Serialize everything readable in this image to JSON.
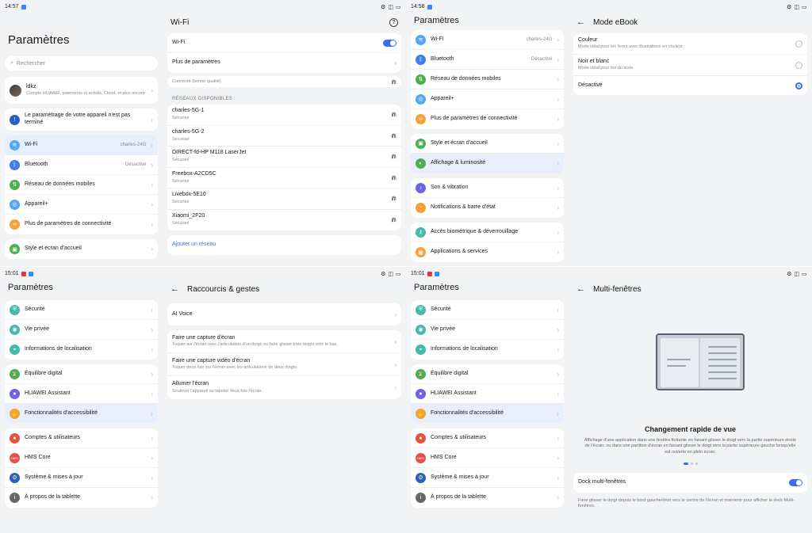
{
  "q1": {
    "status": {
      "time": "14:57",
      "icons": "⚙ ◫ ▭"
    },
    "settings": {
      "title": "Paramètres",
      "search_placeholder": "Rechercher",
      "account": {
        "name": "ldkz",
        "desc": "Compte HUAWEI, paiements et achats, Cloud, et plus encore"
      },
      "setup_notice": "Le paramétrage de votre appareil n'est pas terminé",
      "items": [
        {
          "label": "Wi-Fi",
          "value": "charles-24G",
          "icon": "wifi-icon"
        },
        {
          "label": "Bluetooth",
          "value": "Désactivé",
          "icon": "bluetooth-icon"
        },
        {
          "label": "Réseau de données mobiles",
          "value": "",
          "icon": "mobile-data-icon"
        },
        {
          "label": "Appareil+",
          "value": "",
          "icon": "device-plus-icon"
        },
        {
          "label": "Plus de paramètres de connectivité",
          "value": "",
          "icon": "link-icon"
        }
      ],
      "style_item": "Style et écran d'accueil"
    },
    "wifi": {
      "title": "Wi-Fi",
      "toggle_label": "Wi-Fi",
      "more_params": "Plus de paramètres",
      "connected_status": "Connecté (bonne qualité)",
      "available_label": "RÉSEAUX DISPONIBLES",
      "networks": [
        {
          "name": "charles-5G-1",
          "sec": "Sécurisé"
        },
        {
          "name": "charles-5G-2",
          "sec": "Sécurisé"
        },
        {
          "name": "DIRECT-fd-HP M118 LaserJet",
          "sec": "Sécurisé"
        },
        {
          "name": "Freebox-A2CD5C",
          "sec": "Sécurisé"
        },
        {
          "name": "Livebox-5E10",
          "sec": "Sécurisé"
        },
        {
          "name": "Xiaomi_2F20",
          "sec": "Sécurisé"
        }
      ],
      "add_network": "Ajouter un réseau"
    }
  },
  "q2": {
    "status": {
      "time": "14:58",
      "icons": "⚙ ◫ ▭"
    },
    "settings": {
      "title": "Paramètres",
      "group1": [
        {
          "label": "Wi-Fi",
          "value": "charles-24G"
        },
        {
          "label": "Bluetooth",
          "value": "Désactivé"
        },
        {
          "label": "Réseau de données mobiles",
          "value": ""
        },
        {
          "label": "Appareil+",
          "value": ""
        },
        {
          "label": "Plus de paramètres de connectivité",
          "value": ""
        }
      ],
      "group2": [
        {
          "label": "Style et écran d'accueil"
        },
        {
          "label": "Affichage & luminosité"
        }
      ],
      "group3": [
        {
          "label": "Son & vibration"
        },
        {
          "label": "Notifications & barre d'état"
        }
      ],
      "group4": [
        {
          "label": "Accès biométrique & déverrouillage"
        },
        {
          "label": "Applications & services"
        }
      ]
    },
    "ebook": {
      "title": "Mode eBook",
      "options": [
        {
          "label": "Couleur",
          "desc": "Mode idéal pour les livres avec illustrations en couleur."
        },
        {
          "label": "Noir et blanc",
          "desc": "Mode idéal pour lire du texte."
        },
        {
          "label": "Désactivé",
          "desc": ""
        }
      ]
    }
  },
  "q3": {
    "status": {
      "time": "15:01",
      "icons": "⚙ ◫ ▭"
    },
    "settings": {
      "title": "Paramètres",
      "group1": [
        {
          "label": "Sécurité"
        },
        {
          "label": "Vie privée"
        },
        {
          "label": "Informations de localisation"
        }
      ],
      "group2": [
        {
          "label": "Équilibre digital"
        },
        {
          "label": "HUAWEI Assistant"
        },
        {
          "label": "Fonctionnalités d'accessibilité"
        }
      ],
      "group3": [
        {
          "label": "Comptes & utilisateurs"
        },
        {
          "label": "HMS Core"
        },
        {
          "label": "Système & mises à jour"
        },
        {
          "label": "À propos de la tablette"
        }
      ]
    },
    "gestures": {
      "title": "Raccourcis & gestes",
      "ai_voice": "AI Voice",
      "items": [
        {
          "label": "Faire une capture d'écran",
          "desc": "Toquer sur l'écran avec l'articulation d'un doigt, ou faire glisser trois doigts vers le bas."
        },
        {
          "label": "Faire une capture vidéo d'écran",
          "desc": "Toquer deux fois sur l'écran avec les articulations de deux doigts."
        },
        {
          "label": "Allumer l'écran",
          "desc": "Soulever l'appareil ou tapoter deux fois l'écran."
        }
      ]
    }
  },
  "q4": {
    "status": {
      "time": "15:01",
      "icons": "⚙ ◫ ▭"
    },
    "settings": {
      "title": "Paramètres"
    },
    "multi": {
      "title": "Multi-fenêtres",
      "heading": "Changement rapide de vue",
      "desc": "Affichage d'une application dans une fenêtre flottante en faisant glisser le doigt vers la partie supérieure droite de l'écran, ou dans une partition d'écran en faisant glisser le doigt vers la partie supérieure gauche lorsqu'elle est ouverte en plein écran.",
      "dock_label": "Dock multi-fenêtres",
      "dock_desc": "Faire glisser le doigt depuis le bord gauche/droit vers le centre de l'écran et maintenir pour afficher le dock Multi-fenêtres."
    }
  }
}
